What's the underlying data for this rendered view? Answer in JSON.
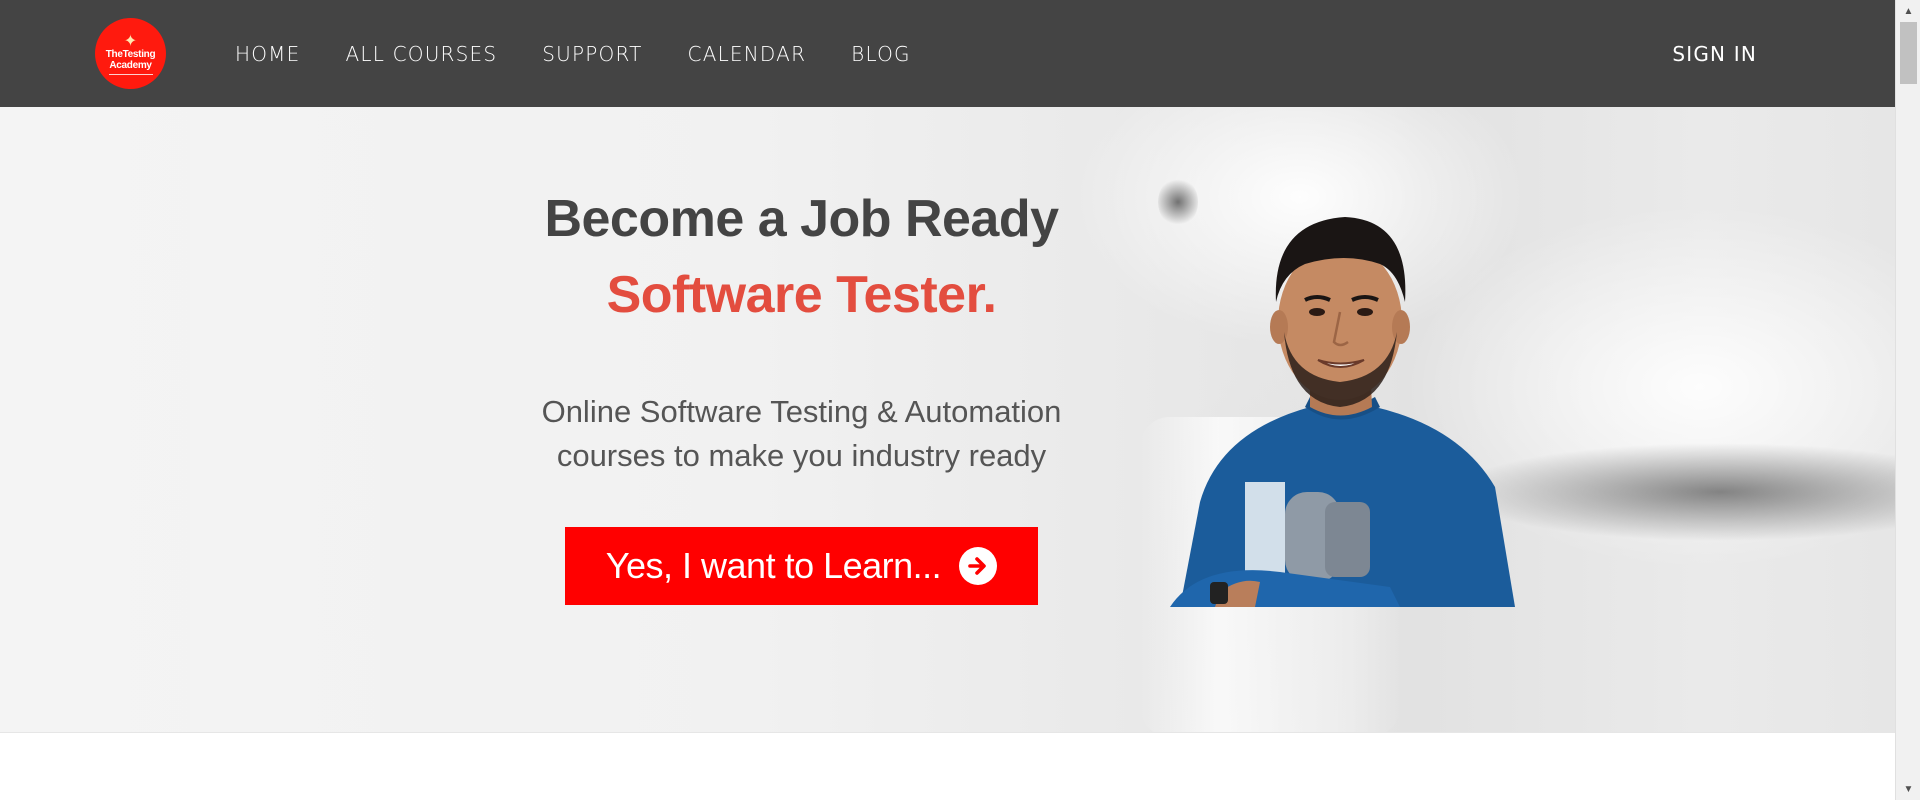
{
  "logo": {
    "line1": "TheTesting",
    "line2": "Academy"
  },
  "nav": {
    "items": [
      {
        "label": "HOME"
      },
      {
        "label": "ALL COURSES"
      },
      {
        "label": "SUPPORT"
      },
      {
        "label": "CALENDAR"
      },
      {
        "label": "BLOG"
      }
    ],
    "sign_in": "SIGN IN"
  },
  "hero": {
    "headline_line1": "Become a Job Ready",
    "headline_line2": "Software Tester.",
    "subtext_line1": "Online Software Testing & Automation",
    "subtext_line2": "courses to make you industry ready",
    "cta_label": "Yes, I want to Learn...",
    "cta_icon": "arrow-right-circle-icon"
  },
  "colors": {
    "navbar": "#444444",
    "accent_red": "#ff0000",
    "headline_red": "#e34d3f",
    "headline_dark": "#444444"
  }
}
